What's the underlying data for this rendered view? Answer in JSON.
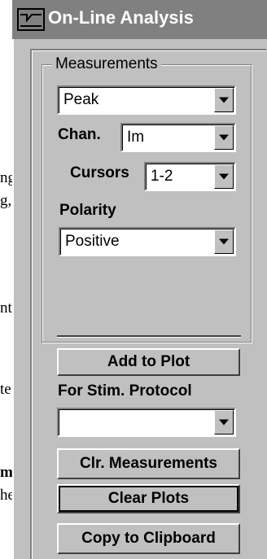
{
  "background_fragments": [
    "ng",
    "g,",
    "nt",
    "te",
    "m",
    "he"
  ],
  "window": {
    "title": "On-Line Analysis",
    "icon": "pulse-waveform-icon"
  },
  "measurements_group": {
    "title": "Measurements",
    "measurement_type": "Peak",
    "chan_label": "Chan.",
    "chan_value": "Im",
    "cursors_label": "Cursors",
    "cursors_value": "1-2",
    "polarity_label": "Polarity",
    "polarity_value": "Positive"
  },
  "buttons": {
    "add_to_plot": "Add to Plot",
    "clr_measurements": "Clr. Measurements",
    "clear_plots": "Clear Plots",
    "copy_to_clipboard": "Copy to Clipboard"
  },
  "stim_protocol": {
    "label": "For Stim. Protocol",
    "value": ""
  },
  "colors": {
    "panel_face": "#c0c0c0",
    "titlebar": "#808080",
    "title_text": "#ffffff"
  }
}
